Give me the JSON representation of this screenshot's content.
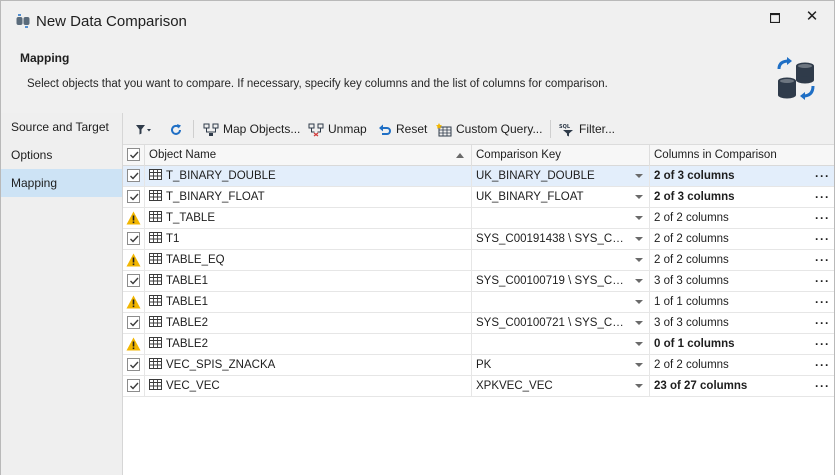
{
  "window": {
    "title": "New Data Comparison",
    "maximize_glyph": "☐",
    "close_glyph": "✕"
  },
  "header": {
    "title": "Mapping",
    "description": "Select objects that you want to compare. If necessary, specify key columns and the list of columns for comparison."
  },
  "sidebar": {
    "items": [
      {
        "label": "Source and Target",
        "active": false
      },
      {
        "label": "Options",
        "active": false
      },
      {
        "label": "Mapping",
        "active": true
      }
    ]
  },
  "toolbar": {
    "map_objects": "Map Objects...",
    "unmap": "Unmap",
    "reset": "Reset",
    "custom_query": "Custom Query...",
    "filter": "Filter..."
  },
  "grid": {
    "headers": {
      "object_name": "Object Name",
      "comparison_key": "Comparison Key",
      "columns_in_comparison": "Columns in Comparison"
    },
    "rows": [
      {
        "status": "checked",
        "name": "T_BINARY_DOUBLE",
        "key": "UK_BINARY_DOUBLE",
        "cols": "2 of 3 columns",
        "bold": true,
        "selected": true
      },
      {
        "status": "checked",
        "name": "T_BINARY_FLOAT",
        "key": "UK_BINARY_FLOAT",
        "cols": "2 of 3 columns",
        "bold": true,
        "selected": false
      },
      {
        "status": "warning",
        "name": "T_TABLE",
        "key": "",
        "cols": "2 of 2 columns",
        "bold": false,
        "selected": false
      },
      {
        "status": "checked",
        "name": "T1",
        "key": "SYS_C00191438 \\ SYS_C001...",
        "cols": "2 of 2 columns",
        "bold": false,
        "selected": false
      },
      {
        "status": "warning",
        "name": "TABLE_EQ",
        "key": "",
        "cols": "2 of 2 columns",
        "bold": false,
        "selected": false
      },
      {
        "status": "checked",
        "name": "TABLE1",
        "key": "SYS_C00100719 \\ SYS_C001...",
        "cols": "3 of 3 columns",
        "bold": false,
        "selected": false
      },
      {
        "status": "warning",
        "name": "TABLE1",
        "key": "",
        "cols": "1 of 1 columns",
        "bold": false,
        "selected": false
      },
      {
        "status": "checked",
        "name": "TABLE2",
        "key": "SYS_C00100721 \\ SYS_C001...",
        "cols": "3 of 3 columns",
        "bold": false,
        "selected": false
      },
      {
        "status": "warning",
        "name": "TABLE2",
        "key": "",
        "cols": "0 of 1 columns",
        "bold": true,
        "selected": false
      },
      {
        "status": "checked",
        "name": "VEC_SPIS_ZNACKA",
        "key": "PK",
        "cols": "2 of 2 columns",
        "bold": false,
        "selected": false
      },
      {
        "status": "checked",
        "name": "VEC_VEC",
        "key": "XPKVEC_VEC",
        "cols": "23 of 27 columns",
        "bold": true,
        "selected": false
      }
    ],
    "more_glyph": "···"
  },
  "colors": {
    "selected_row": "#e3eefb",
    "sidebar_active": "#cde3f5",
    "warning": "#f2b600",
    "accent_blue": "#1f6fc5"
  }
}
